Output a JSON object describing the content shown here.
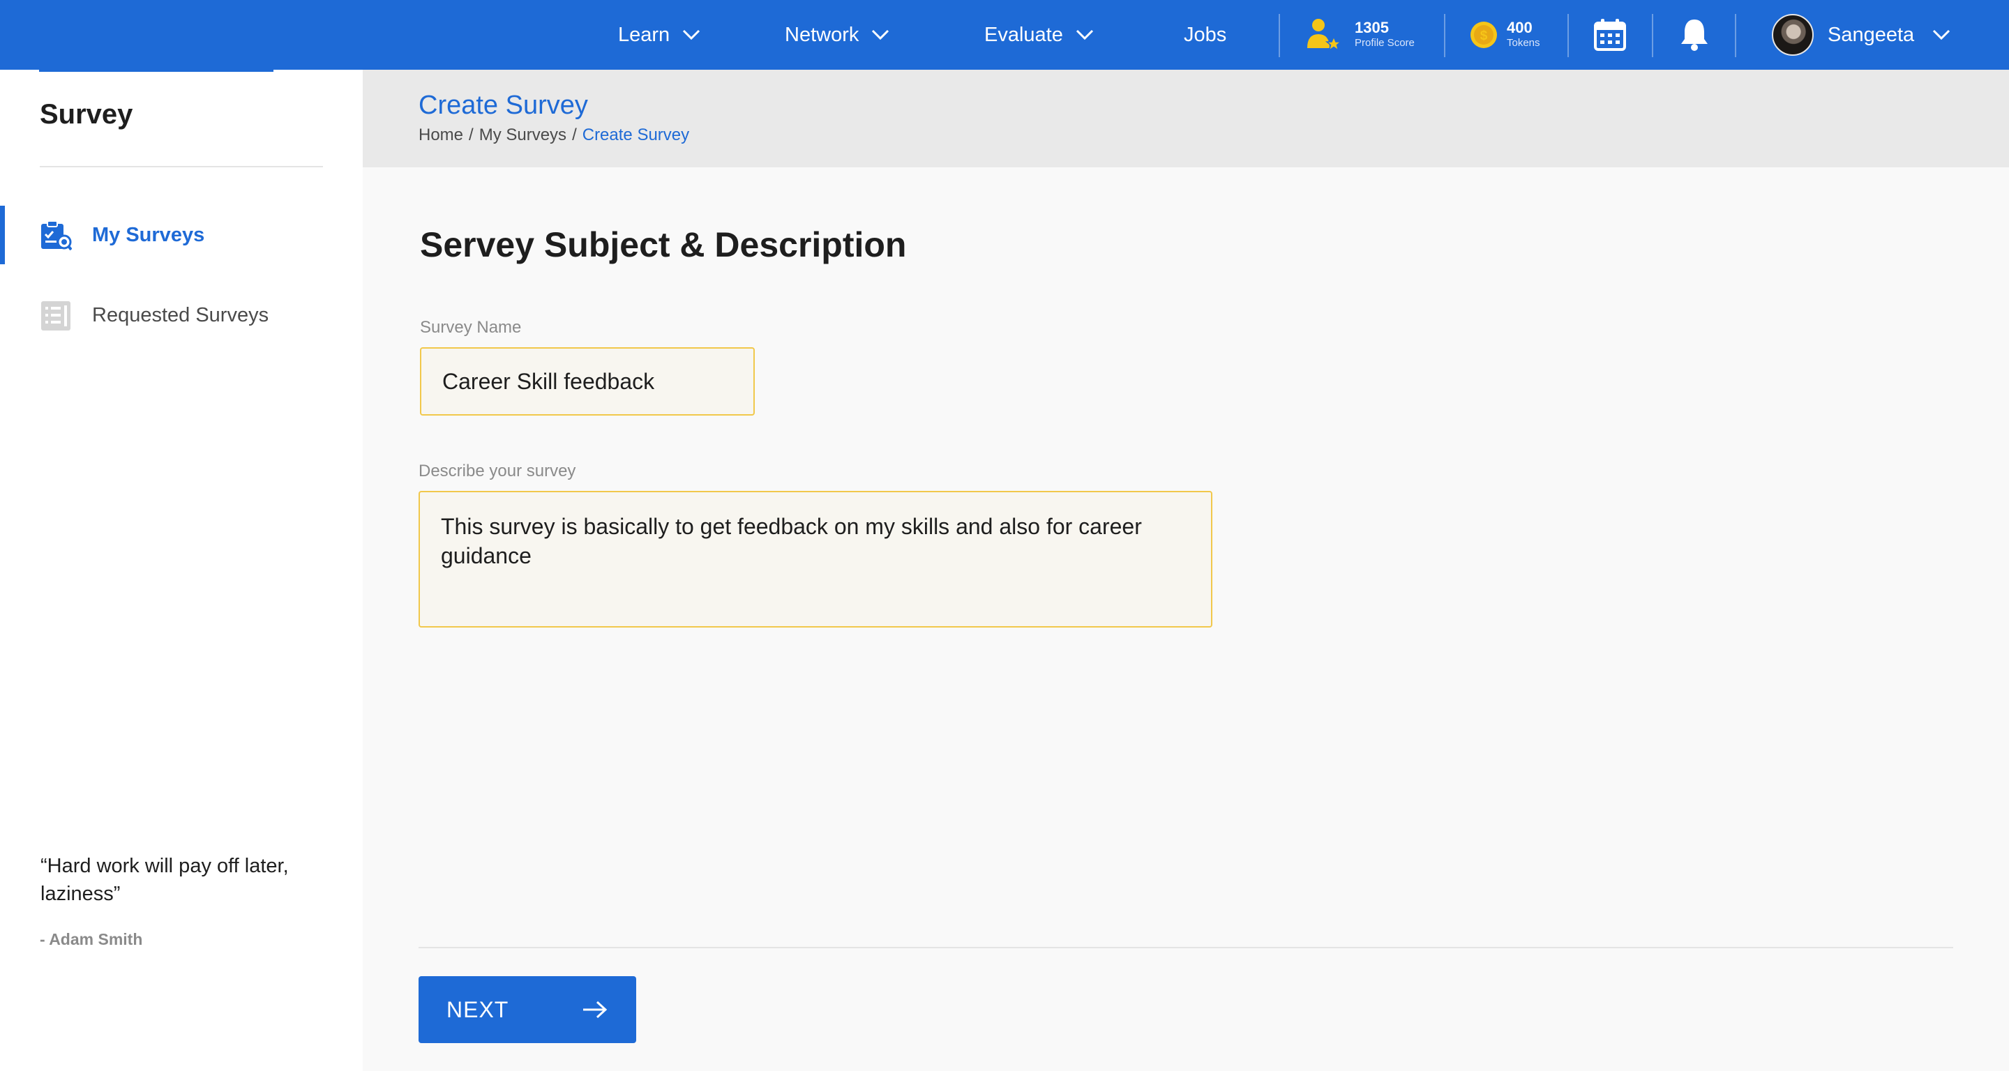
{
  "colors": {
    "brand": "#1e6ad6",
    "gold": "#f5c518",
    "input_border": "#f1c84b"
  },
  "topbar": {
    "nav": [
      {
        "label": "Learn",
        "has_dropdown": true
      },
      {
        "label": "Network",
        "has_dropdown": true
      },
      {
        "label": "Evaluate",
        "has_dropdown": true
      },
      {
        "label": "Jobs",
        "has_dropdown": false
      }
    ],
    "profile_score": {
      "value": "1305",
      "label": "Profile Score",
      "icon": "profile-score-icon"
    },
    "tokens": {
      "value": "400",
      "label": "Tokens",
      "icon": "token-coin-icon"
    },
    "calendar_icon": "calendar-icon",
    "notification_icon": "bell-icon",
    "user": {
      "name": "Sangeeta",
      "avatar": "avatar"
    }
  },
  "sidebar": {
    "title": "Survey",
    "items": [
      {
        "label": "My Surveys",
        "icon": "my-surveys-icon",
        "active": true
      },
      {
        "label": "Requested Surveys",
        "icon": "requested-surveys-icon",
        "active": false
      }
    ],
    "quote": "“Hard work will pay off later, laziness”",
    "quote_author": "- Adam Smith"
  },
  "header": {
    "title": "Create Survey",
    "breadcrumb": [
      "Home",
      "My Surveys",
      "Create Survey"
    ]
  },
  "form": {
    "section_title": "Servey Subject & Description",
    "name_label": "Survey Name",
    "name_value": "Career Skill feedback",
    "desc_label": "Describe your survey",
    "desc_value": "This survey is basically to get feedback on my skills and also for career guidance"
  },
  "actions": {
    "next_label": "NEXT"
  }
}
